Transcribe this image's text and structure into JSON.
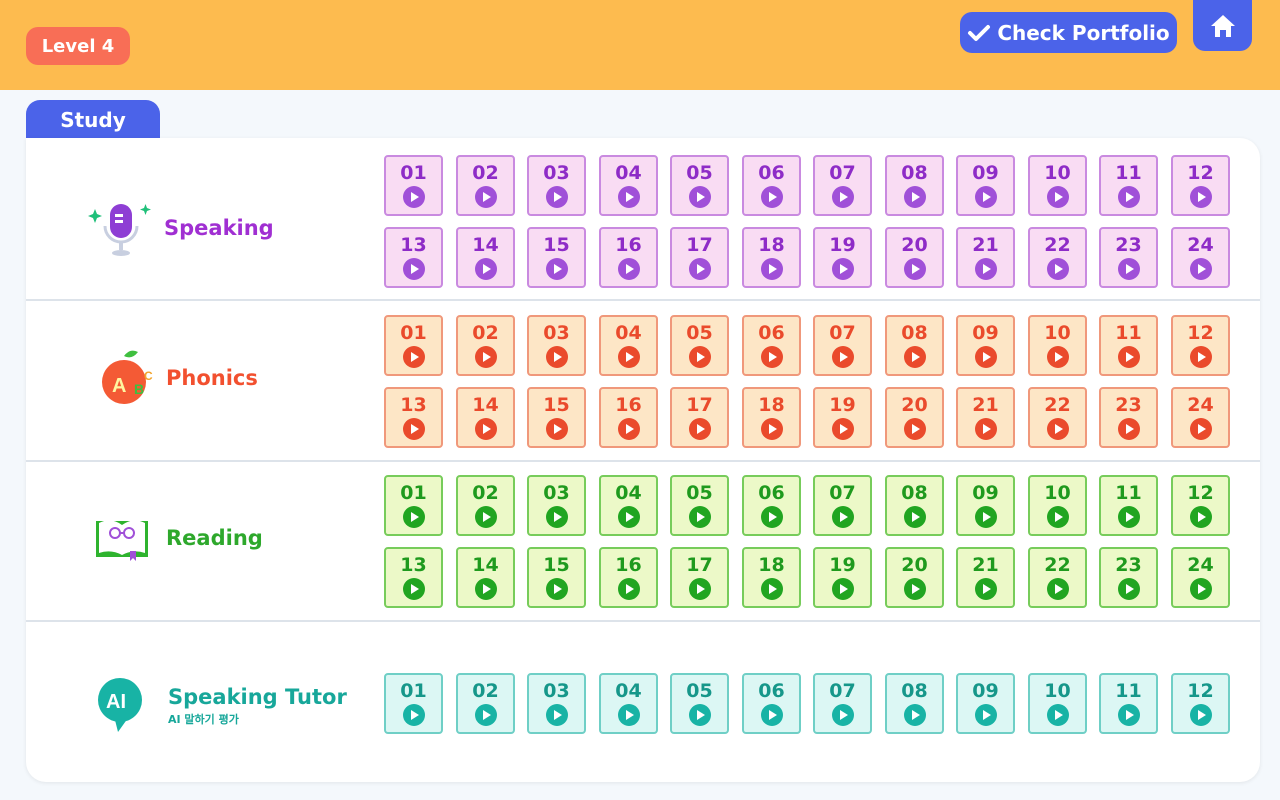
{
  "header": {
    "level_label": "Level 4",
    "check_portfolio_label": "Check Portfolio",
    "home_icon": "home-icon",
    "check_icon": "checkmark-icon"
  },
  "tab": {
    "label": "Study"
  },
  "colors": {
    "topbar": "#fdbb4f",
    "accent_blue": "#4b63e9",
    "level_badge": "#f86e56"
  },
  "rows": [
    {
      "key": "speaking",
      "title": "Speaking",
      "subtitle": "",
      "icon": "microphone-icon",
      "title_color": "#a02fd2",
      "cell_bg": "#f9dcf3",
      "cell_border": "#c98ae0",
      "num_color": "#8e2cc7",
      "play_color": "#a050d8",
      "lessons": [
        "01",
        "02",
        "03",
        "04",
        "05",
        "06",
        "07",
        "08",
        "09",
        "10",
        "11",
        "12",
        "13",
        "14",
        "15",
        "16",
        "17",
        "18",
        "19",
        "20",
        "21",
        "22",
        "23",
        "24"
      ]
    },
    {
      "key": "phonics",
      "title": "Phonics",
      "subtitle": "",
      "icon": "apple-abc-icon",
      "title_color": "#f2502f",
      "cell_bg": "#fde6c6",
      "cell_border": "#f0987b",
      "num_color": "#ea4a2c",
      "play_color": "#ea4a2c",
      "lessons": [
        "01",
        "02",
        "03",
        "04",
        "05",
        "06",
        "07",
        "08",
        "09",
        "10",
        "11",
        "12",
        "13",
        "14",
        "15",
        "16",
        "17",
        "18",
        "19",
        "20",
        "21",
        "22",
        "23",
        "24"
      ]
    },
    {
      "key": "reading",
      "title": "Reading",
      "subtitle": "",
      "icon": "open-book-icon",
      "title_color": "#2ea82c",
      "cell_bg": "#ecf9c8",
      "cell_border": "#77cc5b",
      "num_color": "#1f9a1e",
      "play_color": "#21a521",
      "lessons": [
        "01",
        "02",
        "03",
        "04",
        "05",
        "06",
        "07",
        "08",
        "09",
        "10",
        "11",
        "12",
        "13",
        "14",
        "15",
        "16",
        "17",
        "18",
        "19",
        "20",
        "21",
        "22",
        "23",
        "24"
      ]
    },
    {
      "key": "ai_tutor",
      "title": "Speaking Tutor",
      "subtitle": "AI 말하기 평가",
      "icon": "ai-chat-bubble-icon",
      "title_color": "#17a79a",
      "cell_bg": "#dcf7f4",
      "cell_border": "#6fcfc6",
      "num_color": "#16978a",
      "play_color": "#18b3a5",
      "lessons": [
        "01",
        "02",
        "03",
        "04",
        "05",
        "06",
        "07",
        "08",
        "09",
        "10",
        "11",
        "12"
      ]
    }
  ]
}
